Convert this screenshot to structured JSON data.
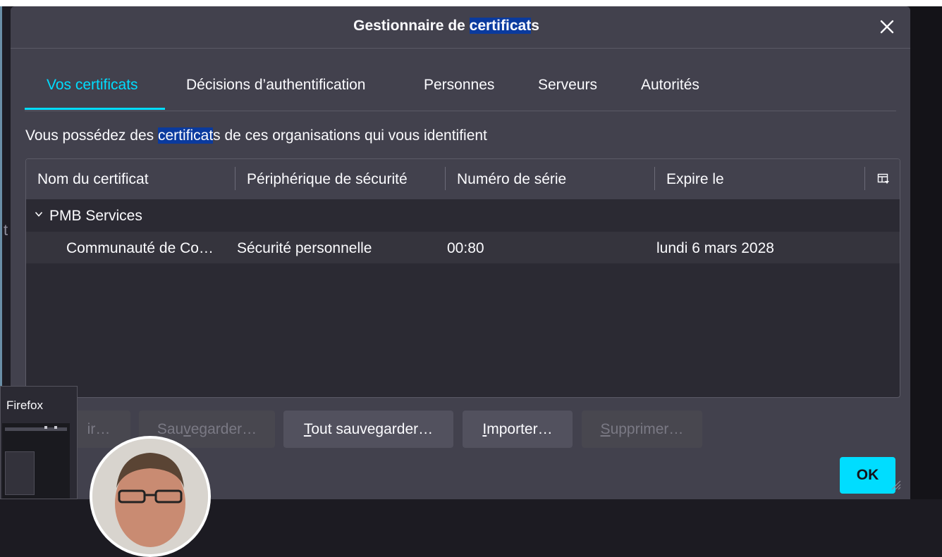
{
  "dialog": {
    "title_prefix": "Gestionnaire de ",
    "title_highlight": "certificat",
    "title_suffix": "s"
  },
  "tabs": [
    {
      "label": "Vos certificats",
      "selected": true
    },
    {
      "label": "Décisions d’authentification",
      "selected": false
    },
    {
      "label": "Personnes",
      "selected": false
    },
    {
      "label": "Serveurs",
      "selected": false
    },
    {
      "label": "Autorités",
      "selected": false
    }
  ],
  "description": {
    "prefix": "Vous possédez des ",
    "highlight": "certificat",
    "suffix": "s de ces organisations qui vous identifient"
  },
  "table": {
    "columns": [
      "Nom du certificat",
      "Périphérique de sécurité",
      "Numéro de série",
      "Expire le"
    ],
    "group": {
      "name": "PMB Services",
      "expanded": true
    },
    "rows": [
      {
        "name": "Communauté de Co…",
        "device": "Sécurité personnelle",
        "serial": "00:80",
        "expires": "lundi 6 mars 2028"
      }
    ]
  },
  "buttons": {
    "view_fragment": "ir…",
    "backup_first": "Sau",
    "backup_u": "v",
    "backup_rest": "egarder…",
    "backup_all_first": "",
    "backup_all_u": "T",
    "backup_all_rest": "out sauvegarder…",
    "import_first": "",
    "import_u": "I",
    "import_rest": "mporter…",
    "delete_first": "",
    "delete_u": "S",
    "delete_rest": "upprimer…",
    "ok": "OK"
  },
  "taskbar_preview": {
    "title": "Firefox"
  },
  "colors": {
    "accent": "#00ddff",
    "dialog_bg": "#42414d",
    "tree_bg": "#2b2a33",
    "selection_highlight": "#0a3a9e"
  },
  "icons": {
    "close": "close-icon",
    "column_picker": "column-picker-icon",
    "twisty": "chevron-down-icon",
    "resize": "resize-grip-icon"
  }
}
